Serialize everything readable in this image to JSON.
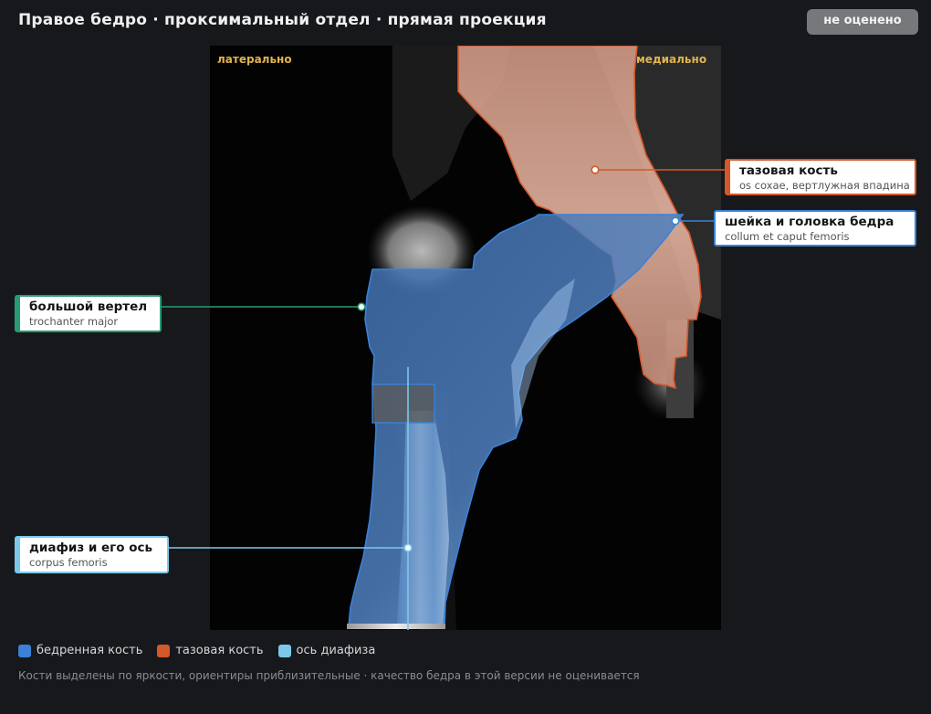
{
  "header": {
    "title": "Правое бедро · проксимальный отдел · прямая проекция",
    "grade_badge": "не оценено"
  },
  "image": {
    "orientation": {
      "left": "латерально",
      "right": "медиально"
    }
  },
  "labels": {
    "pelvis": {
      "name": "тазовая кость",
      "latin": "os coxae, вертлужная впадина"
    },
    "femoral_neck": {
      "name": "шейка и головка бедра",
      "latin": "collum et caput femoris"
    },
    "trochanter": {
      "name": "большой вертел",
      "latin": "trochanter major"
    },
    "shaft": {
      "name": "диафиз и его ось",
      "latin": "corpus femoris"
    }
  },
  "legend": [
    {
      "label": "бедренная кость",
      "color": "#3a82d8"
    },
    {
      "label": "тазовая кость",
      "color": "#d4582a"
    },
    {
      "label": "ось диафиза",
      "color": "#7cc8ea"
    }
  ],
  "footnote": "Кости выделены по яркости, ориентиры приблизительные · качество бедра в этой версии не оценивается"
}
